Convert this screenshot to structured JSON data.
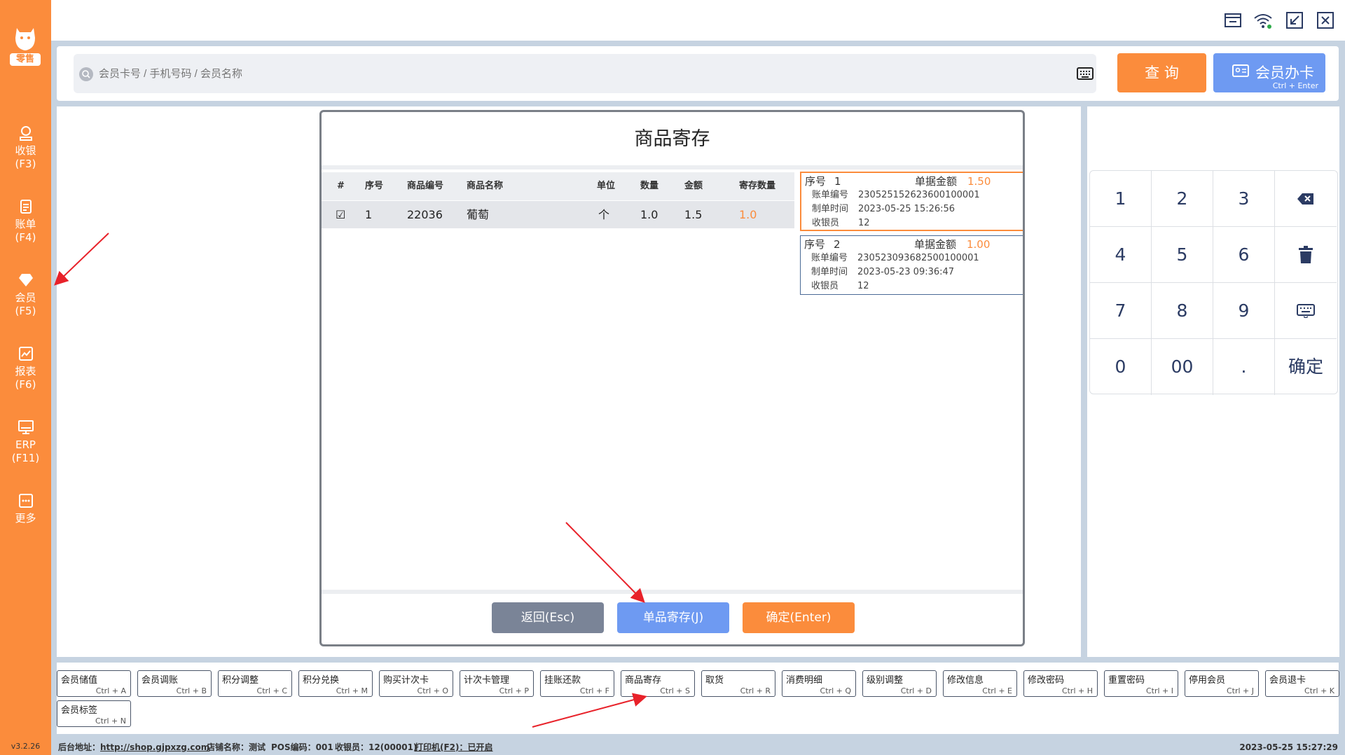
{
  "colors": {
    "accent": "#fb8c3c",
    "primary": "#6e9af2",
    "cancel": "#7a8497",
    "record_active_border": "#fb8c3c",
    "record_border": "#4a6a96"
  },
  "sidebar": {
    "logo_text": "零售",
    "items": [
      {
        "label": "收银",
        "key": "(F3)",
        "icon": "cashier-icon"
      },
      {
        "label": "账单",
        "key": "(F4)",
        "icon": "bill-icon"
      },
      {
        "label": "会员",
        "key": "(F5)",
        "icon": "member-icon"
      },
      {
        "label": "报表",
        "key": "(F6)",
        "icon": "report-icon"
      },
      {
        "label": "ERP",
        "key": "(F11)",
        "icon": "monitor-icon"
      },
      {
        "label": "更多",
        "key": "",
        "icon": "more-icon"
      }
    ],
    "version": "v3.2.26"
  },
  "window_icons": [
    "store-icon",
    "wifi-icon",
    "minimize-icon",
    "close-icon"
  ],
  "search": {
    "placeholder": "会员卡号 / 手机号码 / 会员名称",
    "query_label": "查 询",
    "card_label": "会员办卡",
    "card_shortcut": "Ctrl + Enter"
  },
  "modal": {
    "title": "商品寄存",
    "columns": [
      "#",
      "序号",
      "商品编号",
      "商品名称",
      "单位",
      "数量",
      "金额",
      "寄存数量"
    ],
    "rows": [
      {
        "check": "☑",
        "no": "1",
        "code": "22036",
        "name": "葡萄",
        "unit": "个",
        "qty": "1.0",
        "amount": "1.5",
        "store_qty": "1.0"
      }
    ],
    "records": [
      {
        "seq_label": "序号",
        "seq": "1",
        "amount_label": "单据金额",
        "amount": "1.50",
        "bill_label": "账单编号",
        "bill_no": "230525152623600100001",
        "time_label": "制单时间",
        "time": "2023-05-25 15:26:56",
        "cashier_label": "收银员",
        "cashier": "12"
      },
      {
        "seq_label": "序号",
        "seq": "2",
        "amount_label": "单据金额",
        "amount": "1.00",
        "bill_label": "账单编号",
        "bill_no": "230523093682500100001",
        "time_label": "制单时间",
        "time": "2023-05-23 09:36:47",
        "cashier_label": "收银员",
        "cashier": "12"
      }
    ],
    "buttons": {
      "back": "返回(Esc)",
      "single": "单品寄存(J)",
      "confirm": "确定(Enter)"
    }
  },
  "keypad": {
    "keys": [
      "1",
      "2",
      "3",
      "4",
      "5",
      "6",
      "7",
      "8",
      "9",
      "0",
      "00",
      ".",
      "确定"
    ]
  },
  "functions": [
    {
      "name": "会员储值",
      "key": "Ctrl + A"
    },
    {
      "name": "会员调账",
      "key": "Ctrl + B"
    },
    {
      "name": "积分调整",
      "key": "Ctrl + C"
    },
    {
      "name": "积分兑换",
      "key": "Ctrl + M"
    },
    {
      "name": "购买计次卡",
      "key": "Ctrl + O"
    },
    {
      "name": "计次卡管理",
      "key": "Ctrl + P"
    },
    {
      "name": "挂账还款",
      "key": "Ctrl + F"
    },
    {
      "name": "商品寄存",
      "key": "Ctrl + S"
    },
    {
      "name": "取货",
      "key": "Ctrl + R"
    },
    {
      "name": "消费明细",
      "key": "Ctrl + Q"
    },
    {
      "name": "级别调整",
      "key": "Ctrl + D"
    },
    {
      "name": "修改信息",
      "key": "Ctrl + E"
    },
    {
      "name": "修改密码",
      "key": "Ctrl + H"
    },
    {
      "name": "重置密码",
      "key": "Ctrl + I"
    },
    {
      "name": "停用会员",
      "key": "Ctrl + J"
    },
    {
      "name": "会员退卡",
      "key": "Ctrl + K"
    },
    {
      "name": "会员标签",
      "key": "Ctrl + N"
    }
  ],
  "status": {
    "backend_label": "后台地址：",
    "backend_url": "http://shop.gjpxzg.com",
    "store": "店铺名称：测试",
    "pos": "POS编码：001",
    "cashier": "收银员：12(00001)",
    "printer": "打印机(F2)：已开启",
    "datetime": "2023-05-25 15:27:29"
  }
}
